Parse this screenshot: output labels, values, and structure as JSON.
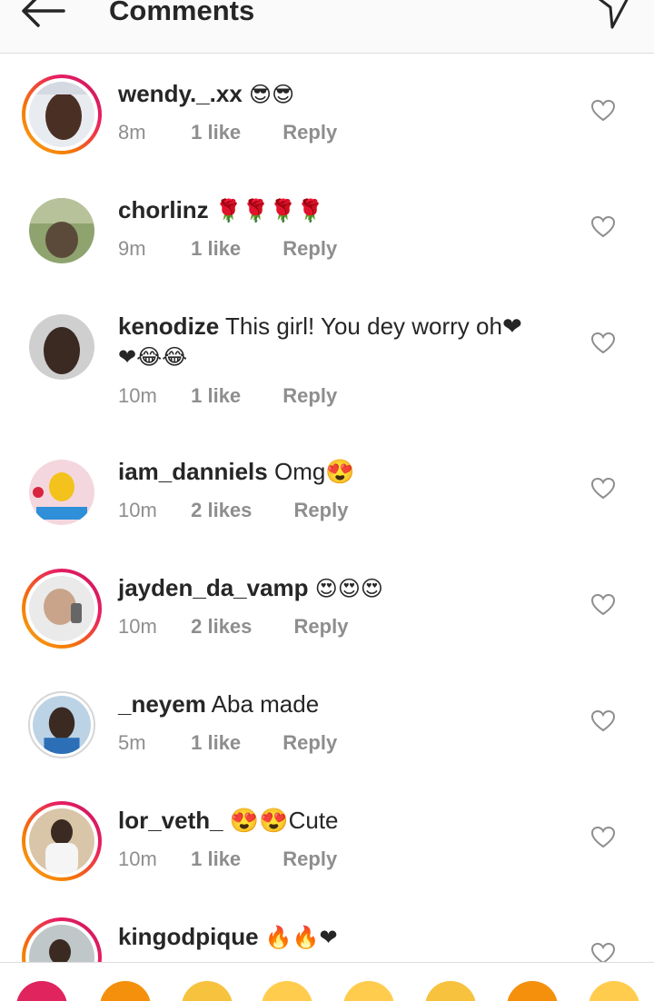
{
  "header": {
    "title": "Comments",
    "back_icon": "back-arrow-icon",
    "send_icon": "send-icon"
  },
  "comments": [
    {
      "username": "wendy._.xx",
      "text": "😎😎",
      "time": "8m",
      "likes": "1 like",
      "reply": "Reply",
      "story_ring": true
    },
    {
      "username": "chorlinz",
      "text": "🌹🌹🌹🌹",
      "time": "9m",
      "likes": "1 like",
      "reply": "Reply",
      "story_ring": false
    },
    {
      "username": "kenodize",
      "text": "This girl! You dey worry oh❤",
      "text2": "❤😂😂",
      "time": "10m",
      "likes": "1 like",
      "reply": "Reply",
      "story_ring": false
    },
    {
      "username": "iam_danniels",
      "text": "Omg😍",
      "time": "10m",
      "likes": "2 likes",
      "reply": "Reply",
      "story_ring": false
    },
    {
      "username": "jayden_da_vamp",
      "text": "😍😍😍",
      "time": "10m",
      "likes": "2 likes",
      "reply": "Reply",
      "story_ring": true
    },
    {
      "username": "_neyem",
      "text": "Aba made",
      "time": "5m",
      "likes": "1 like",
      "reply": "Reply",
      "story_ring": false
    },
    {
      "username": "lor_veth_",
      "text": "😍😍Cute",
      "time": "10m",
      "likes": "1 like",
      "reply": "Reply",
      "story_ring": true
    },
    {
      "username": "kingodpique",
      "text": "🔥🔥❤",
      "story_ring": true
    }
  ],
  "emoji_bar": [
    "❤",
    "🔥",
    "👏",
    "😮",
    "😍",
    "👏",
    "😢",
    "😂"
  ],
  "colors": {
    "text": "#262626",
    "meta": "#8e8e8e",
    "divider": "#dcdcdc",
    "heart_outline": "#8e8e8e"
  }
}
